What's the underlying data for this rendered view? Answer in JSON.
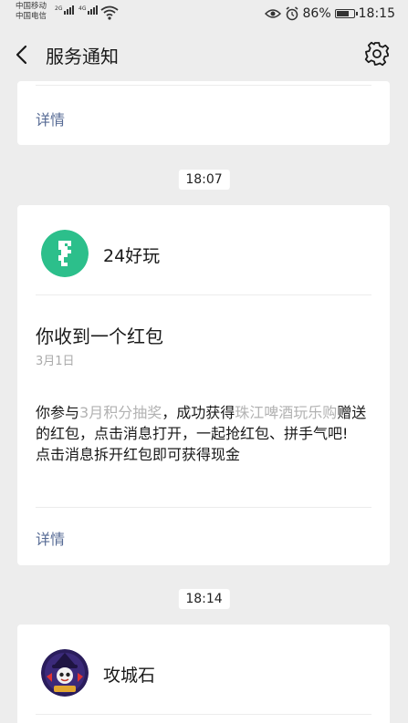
{
  "status_bar": {
    "carrier_1": "中国移动",
    "carrier_2": "中国电信",
    "net_1": "2G",
    "net_2": "4G",
    "battery_percent": "86%",
    "battery_level": 0.86,
    "time": "18:15"
  },
  "header": {
    "title": "服务通知"
  },
  "card_top": {
    "detail_label": "详情"
  },
  "message_1": {
    "time": "18:07",
    "brand": "24好玩",
    "title": "你收到一个红包",
    "date": "3月1日",
    "body": {
      "part1": "你参与",
      "link1": "3月积分抽奖",
      "part2": "，成功获得",
      "link2": "珠江啤酒玩乐购",
      "part3": "赠送的红包，点击消息打开，一起抢红包、拼手气吧!",
      "line2": "点击消息拆开红包即可获得现金"
    },
    "detail_label": "详情"
  },
  "message_2": {
    "time": "18:14",
    "brand": "攻城石"
  },
  "colors": {
    "background": "#ededed",
    "link_blue": "#576b95",
    "brand_green": "#2cbf8b"
  }
}
